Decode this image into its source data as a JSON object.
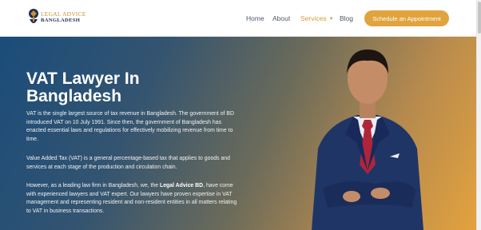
{
  "header": {
    "logo": {
      "line1": "LEGAL ADVICE",
      "line2": "BANGLADESH"
    },
    "nav": [
      {
        "label": "Home",
        "active": false
      },
      {
        "label": "About",
        "active": false
      },
      {
        "label": "Services",
        "active": true,
        "has_dropdown": true
      },
      {
        "label": "Blog",
        "active": false
      }
    ],
    "cta_label": "Schedule an Appointment"
  },
  "hero": {
    "title": "VAT Lawyer In Bangladesh",
    "paragraph1": "VAT is the single largest source of tax revenue in Bangladesh. The government of BD introduced VAT on 10 July 1991. Since then, the government of Bangladesh has enacted essential laws and regulations for effectively mobilizing revenue from time to time.",
    "paragraph2": "Value Added Tax (VAT) is a general percentage-based tax that applies to goods and services at each stage of the production and circulation chain.",
    "paragraph3_before": "However, as a leading law firm in Bangladesh, we, the ",
    "paragraph3_firm": "Legal Advice BD",
    "paragraph3_after": ", have come with experienced lawyers and VAT expert. Our lawyers have proven expertise in VAT management and representing resident and non-resident entities in all matters relating to VAT in business transactions."
  },
  "colors": {
    "accent": "#e0a33e",
    "nav_text": "#4a5a6e",
    "brand_navy": "#1d2a5a",
    "gradient_start": "#1a4c7a",
    "gradient_end": "#e3a23e"
  },
  "icons": [
    "logo-emblem-icon",
    "chevron-down-icon"
  ]
}
